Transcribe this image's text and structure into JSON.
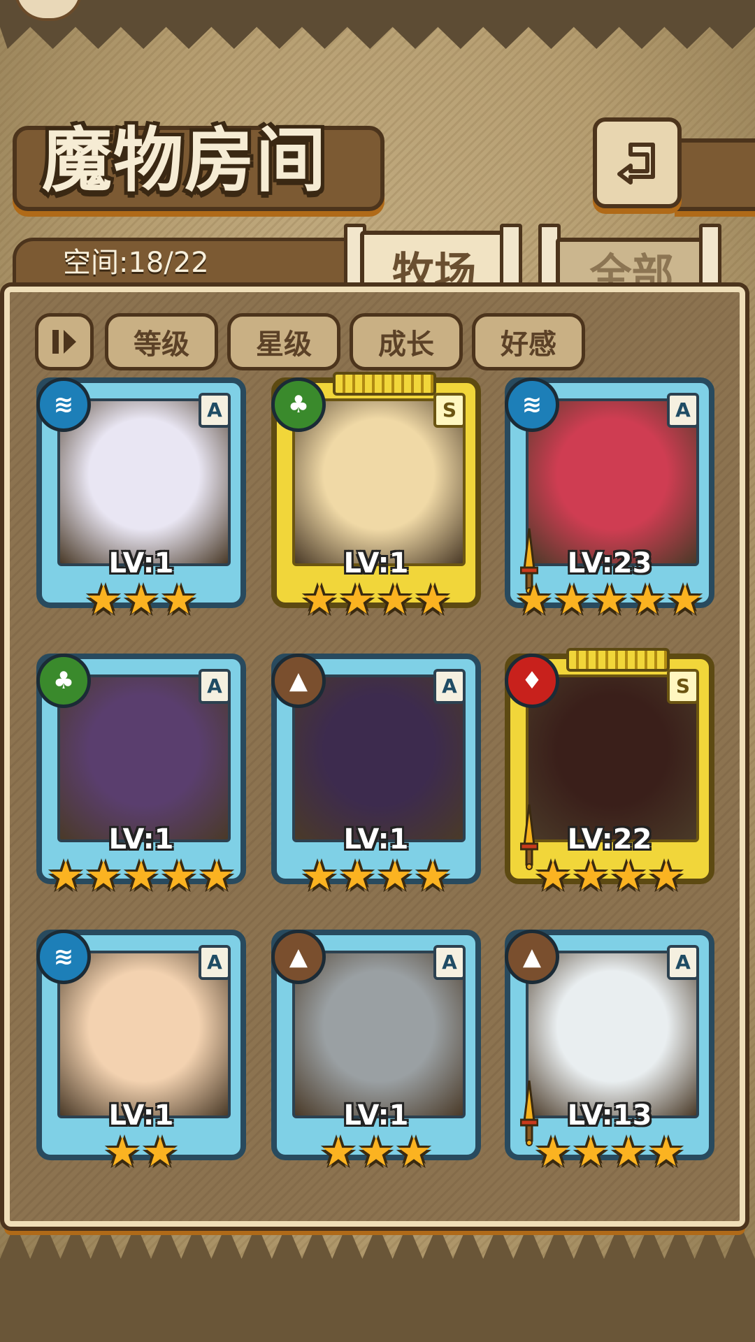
{
  "header": {
    "title": "魔物房间",
    "storage_text": "空间:18/22"
  },
  "tabs": [
    {
      "label": "牧场",
      "active": true
    },
    {
      "label": "全部",
      "active": false
    }
  ],
  "sort_buttons": [
    {
      "label": "等级"
    },
    {
      "label": "星级"
    },
    {
      "label": "成长"
    },
    {
      "label": "好感"
    }
  ],
  "monsters": [
    {
      "level": "LV:1",
      "stars": 3,
      "rank": "A",
      "element": "water",
      "frame": "blue",
      "equipped": false,
      "portrait_color": "#e9e6f3"
    },
    {
      "level": "LV:1",
      "stars": 4,
      "rank": "S",
      "element": "grass",
      "frame": "gold",
      "equipped": false,
      "portrait_color": "#f0d9a6"
    },
    {
      "level": "LV:23",
      "stars": 5,
      "rank": "A",
      "element": "water",
      "frame": "blue",
      "equipped": true,
      "portrait_color": "#cf3d52"
    },
    {
      "level": "LV:1",
      "stars": 5,
      "rank": "A",
      "element": "grass",
      "frame": "blue",
      "equipped": false,
      "portrait_color": "#5a3e6e"
    },
    {
      "level": "LV:1",
      "stars": 4,
      "rank": "A",
      "element": "earth",
      "frame": "blue",
      "equipped": false,
      "portrait_color": "#3d2b4e"
    },
    {
      "level": "LV:22",
      "stars": 4,
      "rank": "S",
      "element": "fire",
      "frame": "gold",
      "equipped": true,
      "portrait_color": "#3a1f1a"
    },
    {
      "level": "LV:1",
      "stars": 2,
      "rank": "A",
      "element": "water",
      "frame": "blue",
      "equipped": false,
      "portrait_color": "#f3d2b0"
    },
    {
      "level": "LV:1",
      "stars": 3,
      "rank": "A",
      "element": "earth",
      "frame": "blue",
      "equipped": false,
      "portrait_color": "#9aa0a3"
    },
    {
      "level": "LV:13",
      "stars": 4,
      "rank": "A",
      "element": "earth",
      "frame": "blue",
      "equipped": true,
      "portrait_color": "#e9eef0"
    }
  ],
  "element_colors": {
    "water": "#1d7fb8",
    "grass": "#3a8a2c",
    "earth": "#7a4f2e",
    "fire": "#c8211c"
  },
  "icons": {
    "back": "back-arrow-icon",
    "sort_toggle": "sort-order-icon",
    "star": "star-icon",
    "sword": "sword-icon"
  }
}
